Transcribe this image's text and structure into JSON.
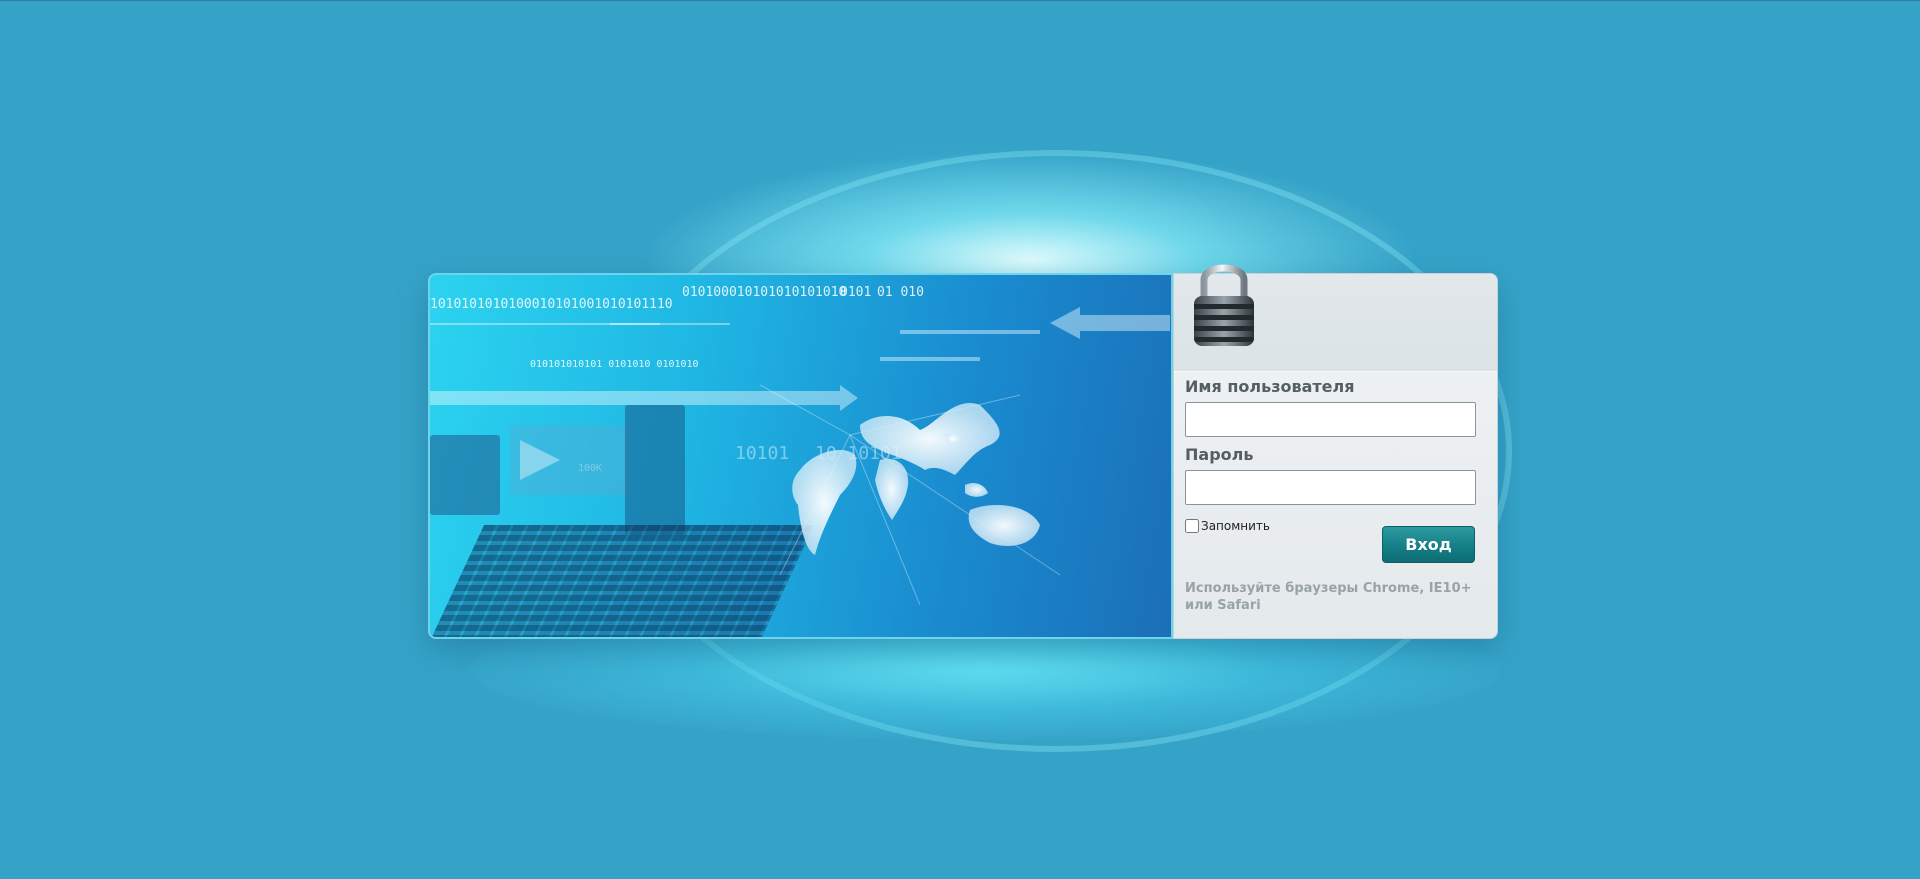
{
  "banner": {
    "binary_lines": [
      "1010101010100010101001010101110",
      "010100010101010101010",
      "0101",
      "01 010",
      "010101010101 0101010 0101010",
      "10101",
      "10 10101",
      "100K"
    ]
  },
  "login": {
    "username_label": "Имя пользователя",
    "username_value": "",
    "password_label": "Пароль",
    "password_value": "",
    "remember_label": "Запомнить",
    "remember_checked": false,
    "submit_label": "Вход",
    "hint": "Используйте браузеры Chrome, IE10+ или Safari"
  },
  "icons": {
    "lock": "padlock-icon",
    "globe": "world-map-icon"
  }
}
